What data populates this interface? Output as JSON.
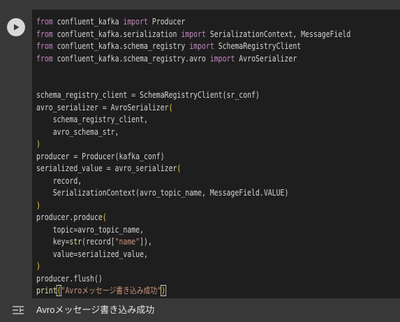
{
  "cell": {
    "run_icon": "play-icon",
    "code_lines": [
      [
        {
          "t": "from",
          "c": "kw"
        },
        {
          "t": " confluent_kafka "
        },
        {
          "t": "import",
          "c": "kw"
        },
        {
          "t": " Producer"
        }
      ],
      [
        {
          "t": "from",
          "c": "kw"
        },
        {
          "t": " confluent_kafka.serialization "
        },
        {
          "t": "import",
          "c": "kw"
        },
        {
          "t": " SerializationContext, MessageField"
        }
      ],
      [
        {
          "t": "from",
          "c": "kw"
        },
        {
          "t": " confluent_kafka.schema_registry "
        },
        {
          "t": "import",
          "c": "kw"
        },
        {
          "t": " SchemaRegistryClient"
        }
      ],
      [
        {
          "t": "from",
          "c": "kw"
        },
        {
          "t": " confluent_kafka.schema_registry.avro "
        },
        {
          "t": "import",
          "c": "kw"
        },
        {
          "t": " AvroSerializer"
        }
      ],
      [],
      [],
      [
        {
          "t": "schema_registry_client = SchemaRegistryClient(sr_conf)"
        }
      ],
      [
        {
          "t": "avro_serializer = AvroSerializer"
        },
        {
          "t": "(",
          "c": "pa"
        }
      ],
      [
        {
          "t": "    schema_registry_client,"
        }
      ],
      [
        {
          "t": "    avro_schema_str,"
        }
      ],
      [
        {
          "t": ")",
          "c": "pa"
        }
      ],
      [
        {
          "t": "producer = Producer(kafka_conf)"
        }
      ],
      [
        {
          "t": "serialized_value = avro_serializer"
        },
        {
          "t": "(",
          "c": "pa"
        }
      ],
      [
        {
          "t": "    record,"
        }
      ],
      [
        {
          "t": "    SerializationContext(avro_topic_name, MessageField.VALUE)"
        }
      ],
      [
        {
          "t": ")",
          "c": "pa"
        }
      ],
      [
        {
          "t": "producer.produce"
        },
        {
          "t": "(",
          "c": "pa"
        }
      ],
      [
        {
          "t": "    topic=avro_topic_name,"
        }
      ],
      [
        {
          "t": "    key="
        },
        {
          "t": "str",
          "c": "fn"
        },
        {
          "t": "(record["
        },
        {
          "t": "\"name\"",
          "c": "str"
        },
        {
          "t": "]),"
        }
      ],
      [
        {
          "t": "    value=serialized_value,"
        }
      ],
      [
        {
          "t": ")",
          "c": "pa"
        }
      ],
      [
        {
          "t": "producer.flush()"
        }
      ],
      [
        {
          "t": "print",
          "c": "fn"
        },
        {
          "t": "(",
          "c": "pa cursor"
        },
        {
          "t": "\"Avroメッセージ書き込み成功\"",
          "c": "str"
        },
        {
          "t": ")",
          "c": "pa cursor"
        }
      ]
    ]
  },
  "output": {
    "icon": "output-settings-icon",
    "text": "Avroメッセージ書き込み成功"
  }
}
